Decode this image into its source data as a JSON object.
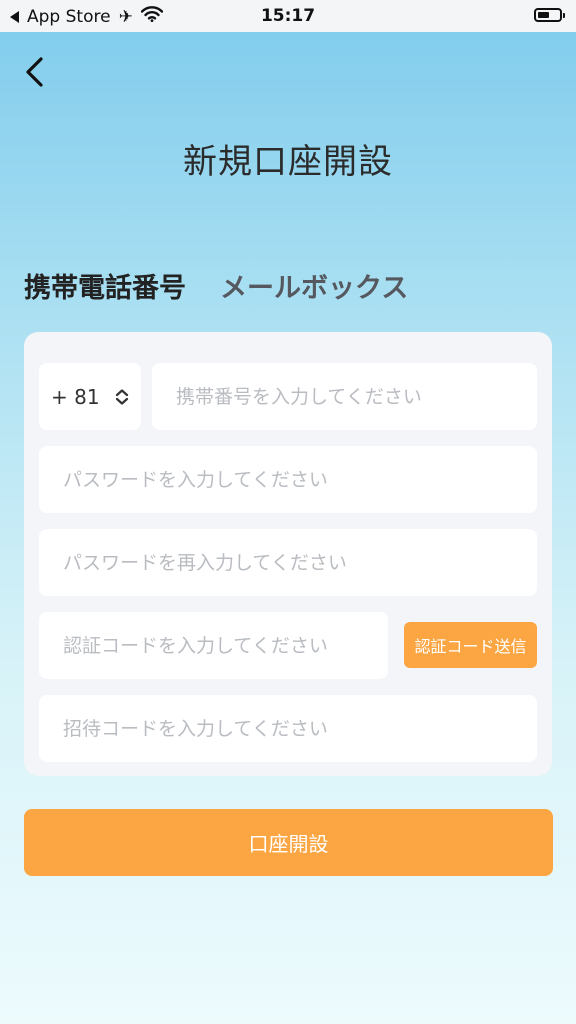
{
  "status_bar": {
    "carrier": "App Store",
    "time": "15:17",
    "battery_level": 0.55
  },
  "nav": {
    "back_icon": "chevron-left-icon"
  },
  "page": {
    "title": "新規口座開設"
  },
  "tabs": [
    {
      "label": "携帯電話番号",
      "active": true
    },
    {
      "label": "メールボックス",
      "active": false
    }
  ],
  "form": {
    "country_code": "+ 81",
    "phone": {
      "value": "",
      "placeholder": "携帯番号を入力してください"
    },
    "password": {
      "value": "",
      "placeholder": "パスワードを入力してください"
    },
    "password_confirm": {
      "value": "",
      "placeholder": "パスワードを再入力してください"
    },
    "verification_code": {
      "value": "",
      "placeholder": "認証コードを入力してください"
    },
    "send_code_label": "認証コード送信",
    "invite_code": {
      "value": "",
      "placeholder": "招待コードを入力してください"
    }
  },
  "submit": {
    "label": "口座開設"
  },
  "colors": {
    "accent": "#fba643",
    "gradient_top": "#7ecbec",
    "gradient_bottom": "#edfbfd",
    "card_bg": "#f3f5f8"
  }
}
